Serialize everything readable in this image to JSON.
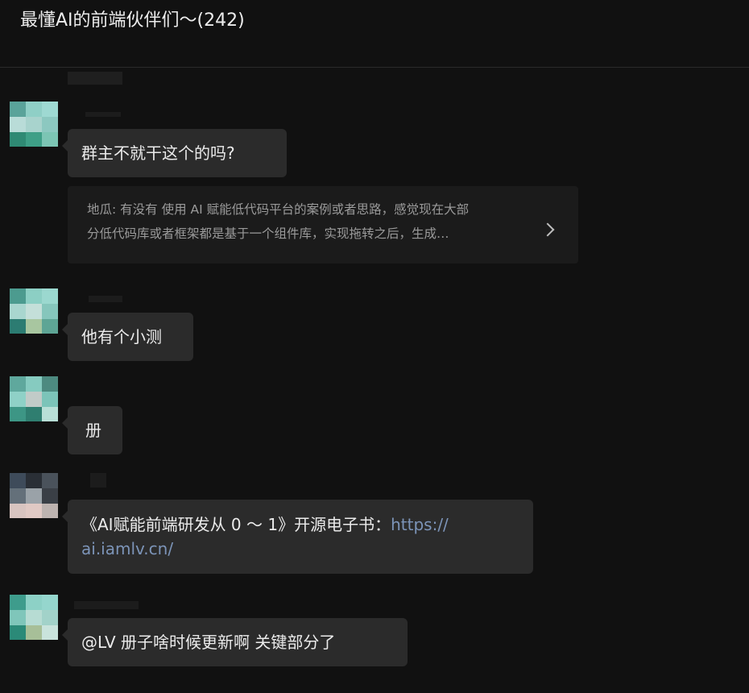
{
  "header": {
    "title": "最懂AI的前端伙伴们～(242)"
  },
  "colors": {
    "background": "#111111",
    "bubble": "#2b2b2b",
    "quote": "#1b1b1b",
    "link": "#7c94b8"
  },
  "messages": [
    {
      "id": "m1",
      "text": "群主不就干这个的吗?"
    },
    {
      "id": "m2",
      "text": "他有个小测"
    },
    {
      "id": "m3",
      "text": "册"
    },
    {
      "id": "m4",
      "text": "《AI赋能前端研发从 0 ～ 1》开源电子书：",
      "link_line1": "https://",
      "link_line2": "ai.iamlv.cn/"
    },
    {
      "id": "m5",
      "text": "@LV  册子啥时候更新啊 关键部分了"
    }
  ],
  "quote": {
    "line1": "地瓜: 有没有 使用 AI 赋能低代码平台的案例或者思路，感觉现在大部",
    "line2": "分低代码库或者框架都是基于一个组件库，实现拖转之后，生成…",
    "expand_icon": "chevron-right-icon"
  }
}
